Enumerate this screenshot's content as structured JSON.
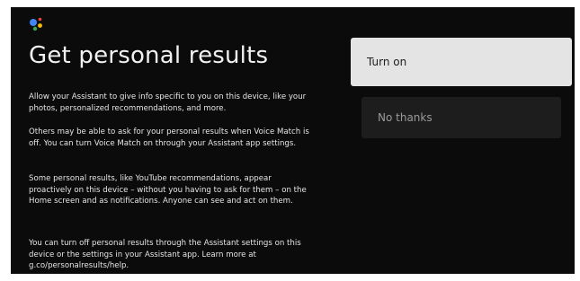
{
  "logo": {
    "icon": "google-assistant-icon",
    "colors": [
      "#4285F4",
      "#EA4335",
      "#FBBC05",
      "#34A853"
    ]
  },
  "title": "Get personal results",
  "paragraphs": [
    "Allow your Assistant to give info specific to you on this device, like your photos, personalized recommendations, and more.",
    "Others may be able to ask for your personal results when Voice Match is off. You can turn Voice Match on through your Assistant app settings.",
    "Some personal results, like YouTube recommendations, appear proactively on this device – without you having to ask for them – on the Home screen and as notifications. Anyone can see and act on them.",
    "You can turn off personal results through the Assistant settings on this device or the settings in your Assistant app. Learn more at g.co/personalresults/help."
  ],
  "buttons": {
    "turn_on": "Turn on",
    "no_thanks": "No thanks"
  }
}
